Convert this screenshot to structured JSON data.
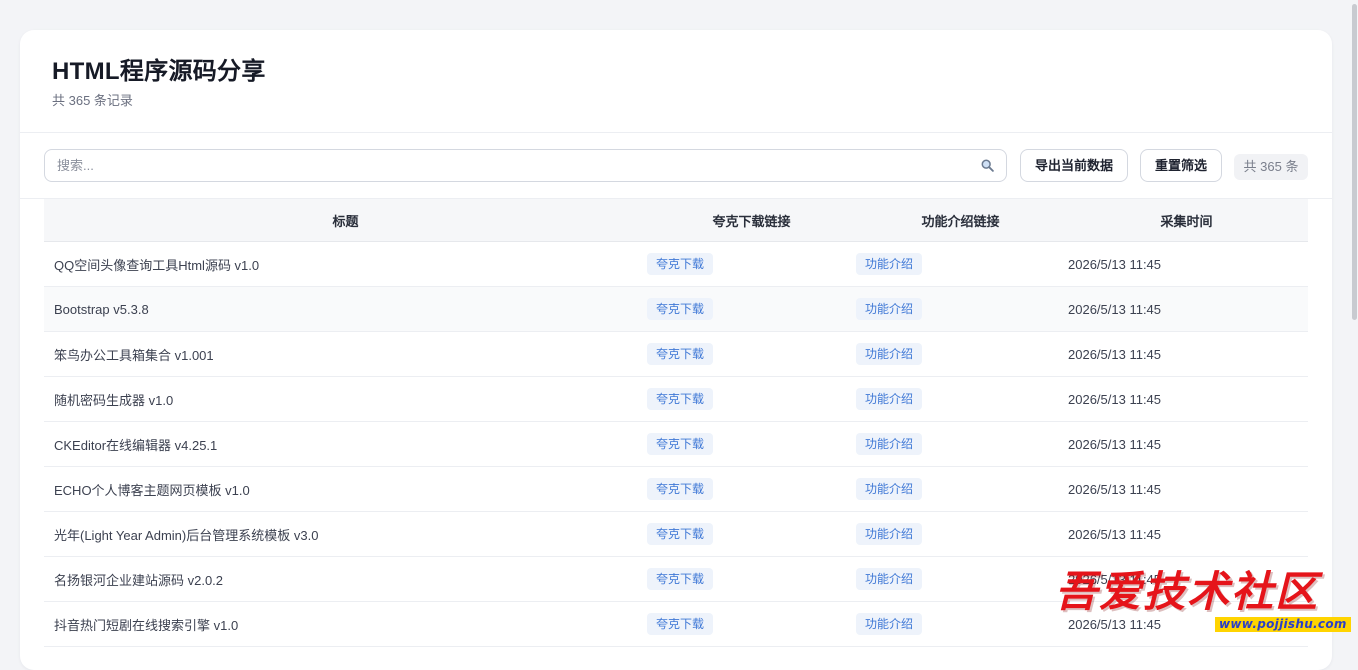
{
  "header": {
    "title": "HTML程序源码分享",
    "subtitle": "共 365 条记录"
  },
  "toolbar": {
    "search_placeholder": "搜索...",
    "search_value": "",
    "export_label": "导出当前数据",
    "reset_label": "重置筛选",
    "count_label": "共 365 条"
  },
  "table": {
    "columns": [
      "标题",
      "夸克下载链接",
      "功能介绍链接",
      "采集时间"
    ],
    "rows": [
      {
        "title": "QQ空间头像查询工具Html源码 v1.0",
        "download": "夸克下载",
        "intro": "功能介绍",
        "time": "2026/5/13 11:45"
      },
      {
        "title": "Bootstrap v5.3.8",
        "download": "夸克下载",
        "intro": "功能介绍",
        "time": "2026/5/13 11:45"
      },
      {
        "title": "笨鸟办公工具箱集合 v1.001",
        "download": "夸克下载",
        "intro": "功能介绍",
        "time": "2026/5/13 11:45"
      },
      {
        "title": "随机密码生成器 v1.0",
        "download": "夸克下载",
        "intro": "功能介绍",
        "time": "2026/5/13 11:45"
      },
      {
        "title": "CKEditor在线编辑器 v4.25.1",
        "download": "夸克下载",
        "intro": "功能介绍",
        "time": "2026/5/13 11:45"
      },
      {
        "title": "ECHO个人博客主题网页模板 v1.0",
        "download": "夸克下载",
        "intro": "功能介绍",
        "time": "2026/5/13 11:45"
      },
      {
        "title": "光年(Light Year Admin)后台管理系统模板 v3.0",
        "download": "夸克下载",
        "intro": "功能介绍",
        "time": "2026/5/13 11:45"
      },
      {
        "title": "名扬银河企业建站源码 v2.0.2",
        "download": "夸克下载",
        "intro": "功能介绍",
        "time": "2026/5/13 11:45"
      },
      {
        "title": "抖音热门短剧在线搜索引擎 v1.0",
        "download": "夸克下载",
        "intro": "功能介绍",
        "time": "2026/5/13 11:45"
      }
    ]
  },
  "watermark": {
    "text": "吾爱技术社区",
    "url": "www.pojjishu.com"
  },
  "colors": {
    "page_bg": "#f3f4f7",
    "card_bg": "#ffffff",
    "link_tag_bg": "#eef3fb",
    "link_tag_text": "#3f78d6",
    "watermark_red": "#e5141a"
  },
  "icons": {
    "search": "search-icon"
  }
}
